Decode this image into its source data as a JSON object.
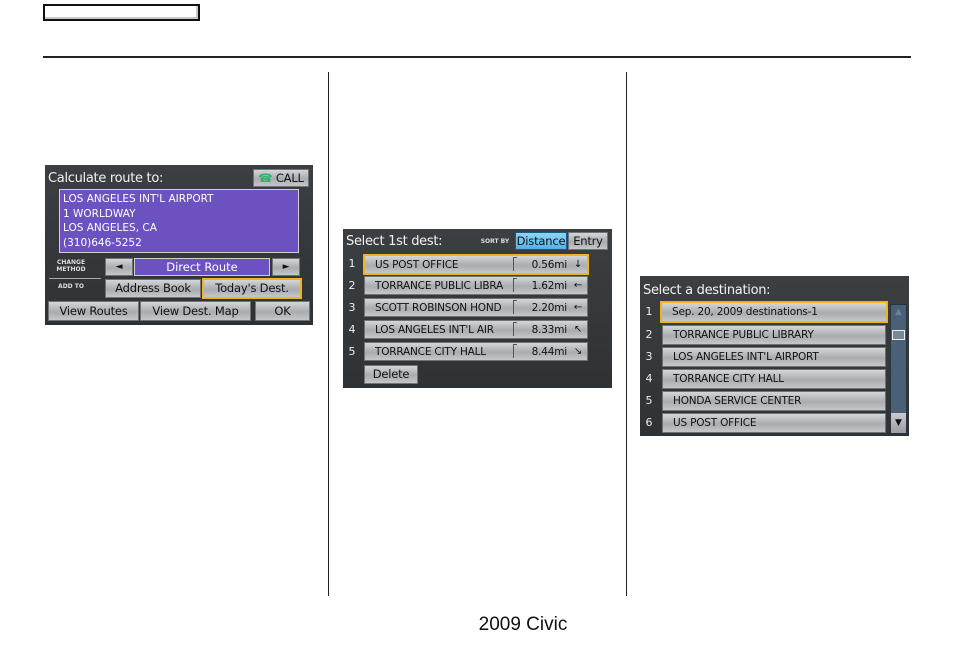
{
  "page": {
    "footer": "2009  Civic"
  },
  "screen_calculate_route": {
    "title": "Calculate route to:",
    "call_label": "CALL",
    "address_lines": [
      "LOS ANGELES INT'L AIRPORT",
      "1 WORLDWAY",
      "LOS ANGELES, CA",
      "(310)646-5252"
    ],
    "change_method_label_1": "CHANGE",
    "change_method_label_2": "METHOD",
    "method_value": "Direct Route",
    "prev_arrow": "◄",
    "next_arrow": "►",
    "add_to_label": "ADD TO",
    "address_book_label": "Address Book",
    "todays_dest_label": "Today's Dest.",
    "view_routes_label": "View Routes",
    "view_dest_map_label": "View Dest. Map",
    "ok_label": "OK"
  },
  "screen_select_first": {
    "title": "Select 1st dest:",
    "sort_by_label": "SORT BY",
    "sort_distance_label": "Distance",
    "sort_entry_label": "Entry",
    "rows": [
      {
        "num": "1",
        "name": "US POST OFFICE",
        "distance": "0.56mi",
        "arrow": "↓"
      },
      {
        "num": "2",
        "name": "TORRANCE PUBLIC LIBRA",
        "distance": "1.62mi",
        "arrow": "←"
      },
      {
        "num": "3",
        "name": "SCOTT ROBINSON HOND",
        "distance": "2.20mi",
        "arrow": "←"
      },
      {
        "num": "4",
        "name": "LOS ANGELES INT'L AIR",
        "distance": "8.33mi",
        "arrow": "↖"
      },
      {
        "num": "5",
        "name": "TORRANCE CITY HALL",
        "distance": "8.44mi",
        "arrow": "↘"
      }
    ],
    "delete_label": "Delete"
  },
  "screen_select_destination": {
    "title": "Select a destination:",
    "rows": [
      {
        "num": "1",
        "name": "Sep. 20, 2009 destinations-1"
      },
      {
        "num": "2",
        "name": "TORRANCE PUBLIC LIBRARY"
      },
      {
        "num": "3",
        "name": "LOS ANGELES INT'L AIRPORT"
      },
      {
        "num": "4",
        "name": "TORRANCE CITY HALL"
      },
      {
        "num": "5",
        "name": "HONDA SERVICE CENTER"
      },
      {
        "num": "6",
        "name": "US POST OFFICE"
      }
    ],
    "scroll_up": "▲",
    "scroll_down": "▼"
  }
}
